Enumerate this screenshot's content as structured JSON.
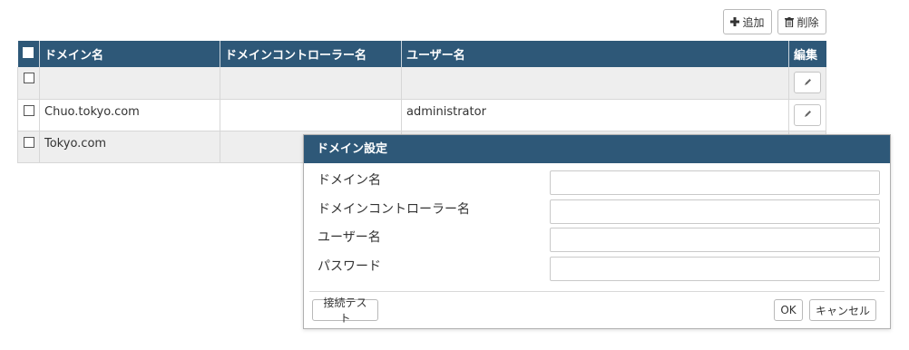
{
  "toolbar": {
    "add_label": "追加",
    "delete_label": "削除"
  },
  "table": {
    "headers": [
      "ドメイン名",
      "ドメインコントローラー名",
      "ユーザー名",
      "編集"
    ],
    "rows": [
      {
        "domain": "",
        "controller": "",
        "user": ""
      },
      {
        "domain": "Chuo.tokyo.com",
        "controller": "",
        "user": "administrator"
      },
      {
        "domain": "Tokyo.com",
        "controller": "",
        "user": ""
      }
    ]
  },
  "dialog": {
    "title": "ドメイン設定",
    "fields": [
      {
        "label": "ドメイン名",
        "value": ""
      },
      {
        "label": "ドメインコントローラー名",
        "value": ""
      },
      {
        "label": "ユーザー名",
        "value": ""
      },
      {
        "label": "パスワード",
        "value": ""
      }
    ],
    "test_label": "接続テスト",
    "ok_label": "OK",
    "cancel_label": "キャンセル"
  },
  "colors": {
    "header_bg": "#2e5878",
    "alt_row_bg": "#eeeeee"
  }
}
